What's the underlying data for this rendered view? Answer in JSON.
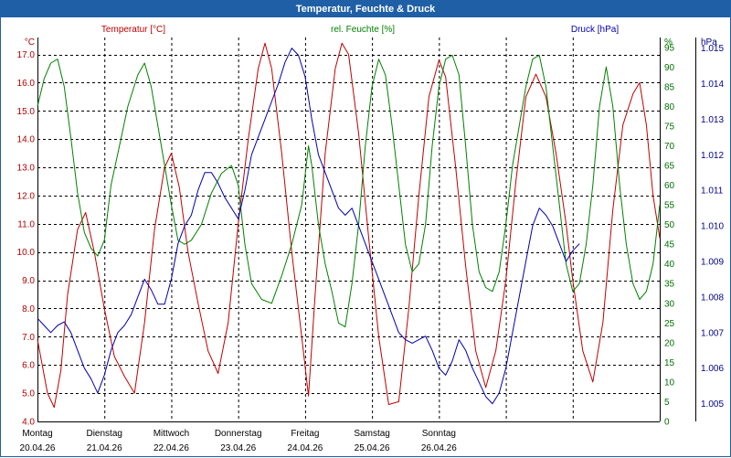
{
  "window": {
    "title": "Temperatur, Feuchte & Druck"
  },
  "chart_data": {
    "type": "line",
    "title": "Temperatur, Feuchte & Druck",
    "x_categories": [
      {
        "day": "Montag",
        "date": "20.04.26"
      },
      {
        "day": "Dienstag",
        "date": "21.04.26"
      },
      {
        "day": "Mittwoch",
        "date": "22.04.26"
      },
      {
        "day": "Donnerstag",
        "date": "23.04.26"
      },
      {
        "day": "Freitag",
        "date": "24.04.26"
      },
      {
        "day": "Samstag",
        "date": "25.04.26"
      },
      {
        "day": "Sonntag",
        "date": "26.04.26"
      }
    ],
    "x_range_days": [
      0,
      7
    ],
    "grid": true,
    "axes": {
      "left": {
        "unit": "°C",
        "min": 4.0,
        "max": 17.6,
        "ticks": [
          "4.0",
          "5.0",
          "6.0",
          "7.0",
          "8.0",
          "9.0",
          "10.0",
          "11.0",
          "12.0",
          "13.0",
          "14.0",
          "15.0",
          "16.0",
          "17.0"
        ],
        "color": "#b00000"
      },
      "middle": {
        "unit": "%",
        "min": 0,
        "max": 97.5,
        "ticks": [
          "0",
          "5",
          "10",
          "15",
          "20",
          "25",
          "30",
          "35",
          "40",
          "45",
          "50",
          "55",
          "60",
          "65",
          "70",
          "75",
          "80",
          "85",
          "90",
          "95"
        ],
        "color": "#007000"
      },
      "right": {
        "unit": "hPa",
        "min": 1004.5,
        "max": 1015.3,
        "ticks": [
          "1.005",
          "1.006",
          "1.007",
          "1.008",
          "1.009",
          "1.010",
          "1.011",
          "1.012",
          "1.013",
          "1.014",
          "1.015"
        ],
        "color": "#00008b"
      }
    },
    "series": [
      {
        "name": "Temperatur [°C]",
        "axis": "left",
        "color": "#c00000",
        "points": [
          [
            0,
            6.9
          ],
          [
            0.15,
            5.0
          ],
          [
            0.25,
            4.5
          ],
          [
            0.35,
            5.8
          ],
          [
            0.45,
            8.5
          ],
          [
            0.6,
            10.8
          ],
          [
            0.72,
            11.4
          ],
          [
            0.85,
            10.0
          ],
          [
            1.0,
            8.0
          ],
          [
            1.15,
            6.3
          ],
          [
            1.3,
            5.6
          ],
          [
            1.45,
            5.0
          ],
          [
            1.6,
            7.5
          ],
          [
            1.75,
            10.8
          ],
          [
            1.9,
            13.0
          ],
          [
            2.0,
            13.5
          ],
          [
            2.12,
            12.3
          ],
          [
            2.25,
            10.0
          ],
          [
            2.4,
            8.2
          ],
          [
            2.55,
            6.5
          ],
          [
            2.7,
            5.7
          ],
          [
            2.85,
            7.5
          ],
          [
            3.0,
            11.0
          ],
          [
            3.15,
            14.0
          ],
          [
            3.3,
            16.5
          ],
          [
            3.4,
            17.4
          ],
          [
            3.5,
            16.5
          ],
          [
            3.65,
            13.5
          ],
          [
            3.8,
            10.0
          ],
          [
            3.95,
            7.0
          ],
          [
            4.05,
            4.9
          ],
          [
            4.15,
            8.5
          ],
          [
            4.3,
            13.5
          ],
          [
            4.45,
            16.5
          ],
          [
            4.55,
            17.4
          ],
          [
            4.65,
            17.0
          ],
          [
            4.8,
            14.2
          ],
          [
            4.95,
            10.5
          ],
          [
            5.1,
            7.0
          ],
          [
            5.25,
            4.6
          ],
          [
            5.4,
            4.7
          ],
          [
            5.55,
            8.0
          ],
          [
            5.7,
            12.0
          ],
          [
            5.85,
            15.5
          ],
          [
            6.0,
            16.8
          ],
          [
            6.1,
            16.2
          ],
          [
            6.25,
            13.0
          ],
          [
            6.4,
            9.5
          ],
          [
            6.55,
            6.5
          ],
          [
            6.7,
            5.2
          ],
          [
            6.85,
            6.5
          ],
          [
            7.0,
            9.0
          ],
          [
            7.15,
            12.5
          ],
          [
            7.3,
            15.5
          ],
          [
            7.45,
            16.3
          ],
          [
            7.6,
            15.5
          ],
          [
            7.75,
            13.5
          ],
          [
            7.9,
            11.0
          ],
          [
            8.0,
            9.0
          ],
          [
            8.15,
            6.5
          ],
          [
            8.3,
            5.4
          ],
          [
            8.45,
            7.5
          ],
          [
            8.6,
            11.5
          ],
          [
            8.75,
            14.5
          ],
          [
            8.9,
            15.6
          ],
          [
            9.0,
            16.0
          ],
          [
            9.1,
            14.5
          ],
          [
            9.2,
            12.0
          ],
          [
            9.3,
            10.5
          ]
        ]
      },
      {
        "name": "rel. Feuchte [%]",
        "axis": "middle",
        "color": "#008000",
        "points": [
          [
            0,
            80
          ],
          [
            0.1,
            87
          ],
          [
            0.2,
            91
          ],
          [
            0.3,
            92
          ],
          [
            0.4,
            85
          ],
          [
            0.5,
            72
          ],
          [
            0.6,
            58
          ],
          [
            0.7,
            48
          ],
          [
            0.8,
            44
          ],
          [
            0.9,
            42
          ],
          [
            1.0,
            46
          ],
          [
            1.1,
            60
          ],
          [
            1.2,
            68
          ],
          [
            1.35,
            80
          ],
          [
            1.5,
            88
          ],
          [
            1.6,
            91
          ],
          [
            1.7,
            85
          ],
          [
            1.85,
            70
          ],
          [
            2.0,
            55
          ],
          [
            2.1,
            46
          ],
          [
            2.2,
            45
          ],
          [
            2.3,
            46
          ],
          [
            2.45,
            50
          ],
          [
            2.6,
            58
          ],
          [
            2.75,
            63
          ],
          [
            2.9,
            65
          ],
          [
            3.0,
            60
          ],
          [
            3.1,
            45
          ],
          [
            3.2,
            35
          ],
          [
            3.35,
            31
          ],
          [
            3.5,
            30
          ],
          [
            3.65,
            37
          ],
          [
            3.8,
            45
          ],
          [
            3.95,
            55
          ],
          [
            4.05,
            70
          ],
          [
            4.1,
            65
          ],
          [
            4.2,
            50
          ],
          [
            4.3,
            40
          ],
          [
            4.4,
            33
          ],
          [
            4.5,
            25
          ],
          [
            4.6,
            24
          ],
          [
            4.7,
            35
          ],
          [
            4.8,
            50
          ],
          [
            4.9,
            70
          ],
          [
            5.0,
            85
          ],
          [
            5.1,
            92
          ],
          [
            5.2,
            88
          ],
          [
            5.3,
            75
          ],
          [
            5.4,
            60
          ],
          [
            5.5,
            45
          ],
          [
            5.6,
            38
          ],
          [
            5.7,
            40
          ],
          [
            5.8,
            50
          ],
          [
            5.9,
            70
          ],
          [
            6.0,
            85
          ],
          [
            6.1,
            92
          ],
          [
            6.2,
            93
          ],
          [
            6.3,
            88
          ],
          [
            6.4,
            70
          ],
          [
            6.5,
            50
          ],
          [
            6.6,
            38
          ],
          [
            6.7,
            34
          ],
          [
            6.8,
            33
          ],
          [
            6.9,
            38
          ],
          [
            7.0,
            50
          ],
          [
            7.1,
            65
          ],
          [
            7.2,
            75
          ],
          [
            7.3,
            85
          ],
          [
            7.4,
            92
          ],
          [
            7.5,
            93
          ],
          [
            7.6,
            85
          ],
          [
            7.7,
            70
          ],
          [
            7.8,
            55
          ],
          [
            7.9,
            40
          ],
          [
            8.0,
            33
          ],
          [
            8.1,
            35
          ],
          [
            8.2,
            45
          ],
          [
            8.3,
            60
          ],
          [
            8.4,
            80
          ],
          [
            8.5,
            90
          ],
          [
            8.6,
            80
          ],
          [
            8.7,
            60
          ],
          [
            8.8,
            45
          ],
          [
            8.9,
            35
          ],
          [
            9.0,
            31
          ],
          [
            9.1,
            33
          ],
          [
            9.2,
            40
          ],
          [
            9.3,
            55
          ]
        ]
      },
      {
        "name": "Druck [hPa]",
        "axis": "right",
        "color": "#0000b0",
        "points": [
          [
            0,
            1007.4
          ],
          [
            0.1,
            1007.2
          ],
          [
            0.2,
            1007.0
          ],
          [
            0.3,
            1007.2
          ],
          [
            0.4,
            1007.3
          ],
          [
            0.5,
            1007.0
          ],
          [
            0.6,
            1006.5
          ],
          [
            0.7,
            1006.0
          ],
          [
            0.8,
            1005.7
          ],
          [
            0.9,
            1005.3
          ],
          [
            1.0,
            1005.8
          ],
          [
            1.1,
            1006.5
          ],
          [
            1.2,
            1007.0
          ],
          [
            1.3,
            1007.2
          ],
          [
            1.4,
            1007.5
          ],
          [
            1.5,
            1008.0
          ],
          [
            1.6,
            1008.5
          ],
          [
            1.7,
            1008.2
          ],
          [
            1.8,
            1007.8
          ],
          [
            1.9,
            1007.8
          ],
          [
            2.0,
            1008.5
          ],
          [
            2.1,
            1009.5
          ],
          [
            2.2,
            1010.0
          ],
          [
            2.3,
            1010.3
          ],
          [
            2.4,
            1011.0
          ],
          [
            2.5,
            1011.5
          ],
          [
            2.6,
            1011.5
          ],
          [
            2.7,
            1011.2
          ],
          [
            2.8,
            1010.8
          ],
          [
            2.9,
            1010.5
          ],
          [
            3.0,
            1010.2
          ],
          [
            3.1,
            1011.0
          ],
          [
            3.2,
            1012.0
          ],
          [
            3.3,
            1012.5
          ],
          [
            3.4,
            1013.0
          ],
          [
            3.5,
            1013.5
          ],
          [
            3.6,
            1014.0
          ],
          [
            3.7,
            1014.6
          ],
          [
            3.8,
            1015.0
          ],
          [
            3.9,
            1014.8
          ],
          [
            4.0,
            1014.2
          ],
          [
            4.1,
            1013.0
          ],
          [
            4.2,
            1012.0
          ],
          [
            4.3,
            1011.5
          ],
          [
            4.4,
            1011.0
          ],
          [
            4.5,
            1010.5
          ],
          [
            4.6,
            1010.3
          ],
          [
            4.7,
            1010.5
          ],
          [
            4.8,
            1010.0
          ],
          [
            4.9,
            1009.5
          ],
          [
            5.0,
            1009.0
          ],
          [
            5.1,
            1008.5
          ],
          [
            5.2,
            1008.0
          ],
          [
            5.3,
            1007.5
          ],
          [
            5.4,
            1007.0
          ],
          [
            5.5,
            1006.8
          ],
          [
            5.6,
            1006.7
          ],
          [
            5.7,
            1006.8
          ],
          [
            5.8,
            1006.9
          ],
          [
            5.9,
            1006.5
          ],
          [
            6.0,
            1006.0
          ],
          [
            6.1,
            1005.8
          ],
          [
            6.2,
            1006.2
          ],
          [
            6.3,
            1006.8
          ],
          [
            6.4,
            1006.5
          ],
          [
            6.5,
            1006.0
          ],
          [
            6.6,
            1005.6
          ],
          [
            6.7,
            1005.2
          ],
          [
            6.8,
            1005.0
          ],
          [
            6.9,
            1005.3
          ],
          [
            7.0,
            1006.0
          ],
          [
            7.1,
            1007.0
          ],
          [
            7.2,
            1008.0
          ],
          [
            7.3,
            1009.0
          ],
          [
            7.4,
            1010.0
          ],
          [
            7.5,
            1010.5
          ],
          [
            7.6,
            1010.3
          ],
          [
            7.7,
            1010.0
          ],
          [
            7.8,
            1009.5
          ],
          [
            7.9,
            1009.0
          ],
          [
            8.0,
            1009.3
          ],
          [
            8.1,
            1009.5
          ]
        ]
      }
    ]
  }
}
